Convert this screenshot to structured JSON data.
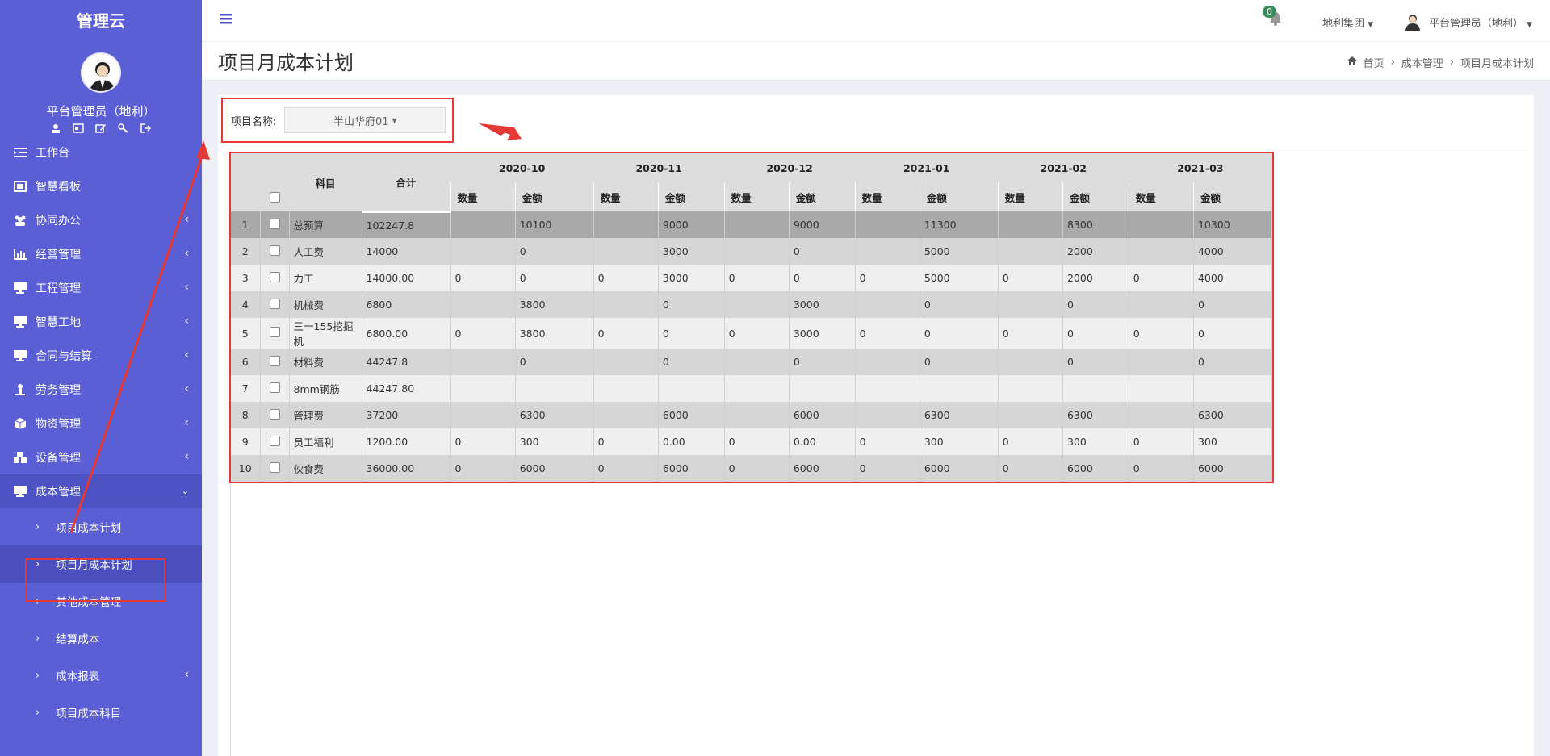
{
  "sidebar": {
    "brand": "管理云",
    "user_name": "平台管理员（地利）",
    "menu": [
      {
        "label": "工作台",
        "icon": "list-indent-icon",
        "has_arrow": false
      },
      {
        "label": "智慧看板",
        "icon": "image-frame-icon",
        "has_arrow": false
      },
      {
        "label": "协同办公",
        "icon": "users-icon",
        "has_arrow": true
      },
      {
        "label": "经营管理",
        "icon": "bar-chart-icon",
        "has_arrow": true
      },
      {
        "label": "工程管理",
        "icon": "monitor-icon",
        "has_arrow": true
      },
      {
        "label": "智慧工地",
        "icon": "monitor-icon",
        "has_arrow": true
      },
      {
        "label": "合同与结算",
        "icon": "monitor-icon",
        "has_arrow": true
      },
      {
        "label": "劳务管理",
        "icon": "worker-icon",
        "has_arrow": true
      },
      {
        "label": "物资管理",
        "icon": "cube-icon",
        "has_arrow": true
      },
      {
        "label": "设备管理",
        "icon": "cubes-icon",
        "has_arrow": true
      },
      {
        "label": "成本管理",
        "icon": "monitor-icon",
        "has_arrow": true,
        "open": true
      }
    ],
    "submenu": [
      {
        "label": "项目成本计划",
        "has_arrow": false
      },
      {
        "label": "项目月成本计划",
        "has_arrow": false,
        "active": true
      },
      {
        "label": "其他成本管理",
        "has_arrow": false
      },
      {
        "label": "结算成本",
        "has_arrow": false
      },
      {
        "label": "成本报表",
        "has_arrow": true
      },
      {
        "label": "项目成本科目",
        "has_arrow": false
      }
    ]
  },
  "topbar": {
    "notification_count": "0",
    "org": "地利集团",
    "user": "平台管理员（地利）"
  },
  "header": {
    "title": "项目月成本计划",
    "breadcrumbs": [
      "首页",
      "成本管理",
      "项目月成本计划"
    ]
  },
  "filter": {
    "label": "项目名称:",
    "selected": "半山华府01"
  },
  "table": {
    "col_subject": "科目",
    "col_total": "合计",
    "months": [
      "2020-10",
      "2020-11",
      "2020-12",
      "2021-01",
      "2021-02",
      "2021-03"
    ],
    "sub_qty": "数量",
    "sub_amount": "金额",
    "rows": [
      {
        "no": "1",
        "subject": "总预算",
        "total": "102247.8",
        "cells": [
          [
            "",
            "10100"
          ],
          [
            "",
            "9000"
          ],
          [
            "",
            "9000"
          ],
          [
            "",
            "11300"
          ],
          [
            "",
            "8300"
          ],
          [
            "",
            "10300"
          ]
        ]
      },
      {
        "no": "2",
        "subject": "人工费",
        "total": "14000",
        "cells": [
          [
            "",
            "0"
          ],
          [
            "",
            "3000"
          ],
          [
            "",
            "0"
          ],
          [
            "",
            "5000"
          ],
          [
            "",
            "2000"
          ],
          [
            "",
            "4000"
          ]
        ]
      },
      {
        "no": "3",
        "subject": "力工",
        "total": "14000.00",
        "cells": [
          [
            "0",
            "0"
          ],
          [
            "0",
            "3000"
          ],
          [
            "0",
            "0"
          ],
          [
            "0",
            "5000"
          ],
          [
            "0",
            "2000"
          ],
          [
            "0",
            "4000"
          ]
        ]
      },
      {
        "no": "4",
        "subject": "机械费",
        "total": "6800",
        "cells": [
          [
            "",
            "3800"
          ],
          [
            "",
            "0"
          ],
          [
            "",
            "3000"
          ],
          [
            "",
            "0"
          ],
          [
            "",
            "0"
          ],
          [
            "",
            "0"
          ]
        ]
      },
      {
        "no": "5",
        "subject": "三一155挖掘机",
        "total": "6800.00",
        "cells": [
          [
            "0",
            "3800"
          ],
          [
            "0",
            "0"
          ],
          [
            "0",
            "3000"
          ],
          [
            "0",
            "0"
          ],
          [
            "0",
            "0"
          ],
          [
            "0",
            "0"
          ]
        ]
      },
      {
        "no": "6",
        "subject": "材料费",
        "total": "44247.8",
        "cells": [
          [
            "",
            "0"
          ],
          [
            "",
            "0"
          ],
          [
            "",
            "0"
          ],
          [
            "",
            "0"
          ],
          [
            "",
            "0"
          ],
          [
            "",
            "0"
          ]
        ]
      },
      {
        "no": "7",
        "subject": "8mm钢筋",
        "total": "44247.80",
        "cells": [
          [
            "",
            ""
          ],
          [
            "",
            ""
          ],
          [
            "",
            ""
          ],
          [
            "",
            ""
          ],
          [
            "",
            ""
          ],
          [
            "",
            ""
          ]
        ]
      },
      {
        "no": "8",
        "subject": "管理费",
        "total": "37200",
        "cells": [
          [
            "",
            "6300"
          ],
          [
            "",
            "6000"
          ],
          [
            "",
            "6000"
          ],
          [
            "",
            "6300"
          ],
          [
            "",
            "6300"
          ],
          [
            "",
            "6300"
          ]
        ]
      },
      {
        "no": "9",
        "subject": "员工福利",
        "total": "1200.00",
        "cells": [
          [
            "0",
            "300"
          ],
          [
            "0",
            "0.00"
          ],
          [
            "0",
            "0.00"
          ],
          [
            "0",
            "300"
          ],
          [
            "0",
            "300"
          ],
          [
            "0",
            "300"
          ]
        ]
      },
      {
        "no": "10",
        "subject": "伙食费",
        "total": "36000.00",
        "cells": [
          [
            "0",
            "6000"
          ],
          [
            "0",
            "6000"
          ],
          [
            "0",
            "6000"
          ],
          [
            "0",
            "6000"
          ],
          [
            "0",
            "6000"
          ],
          [
            "0",
            "6000"
          ]
        ]
      }
    ]
  },
  "colors": {
    "sidebar_bg": "#5a5fd6",
    "annotation_red": "#e53935",
    "badge_green": "#3c8c5c"
  }
}
